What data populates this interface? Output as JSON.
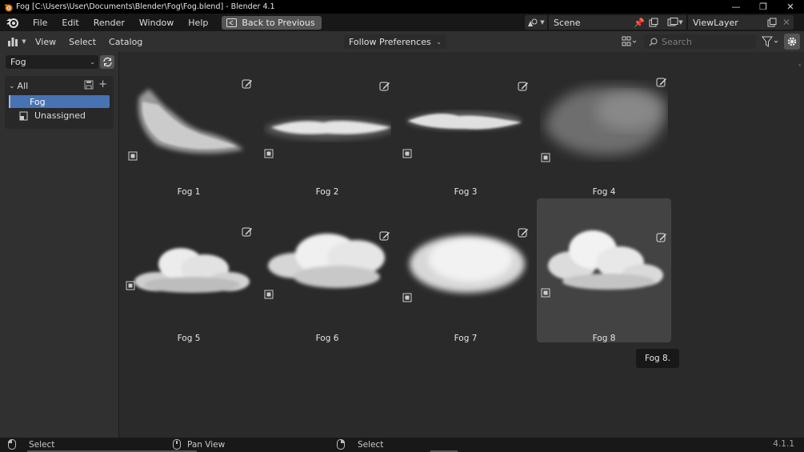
{
  "window": {
    "title": "Fog [C:\\Users\\User\\Documents\\Blender\\Fog\\Fog.blend] - Blender 4.1",
    "controls": [
      "minimize-icon",
      "restore-icon",
      "close-icon"
    ]
  },
  "menubar": {
    "items": [
      "File",
      "Edit",
      "Render",
      "Window",
      "Help"
    ],
    "back_button": "Back to Previous",
    "scene": "Scene",
    "view_layer": "ViewLayer"
  },
  "editor_header": {
    "menus": [
      "View",
      "Select",
      "Catalog"
    ],
    "import_method": "Follow Preferences",
    "search_placeholder": "Search"
  },
  "sidebar": {
    "library": "Fog",
    "catalog_root": "All",
    "catalogs": [
      "Fog"
    ],
    "unassigned": "Unassigned"
  },
  "assets": [
    {
      "name": "Fog 1"
    },
    {
      "name": "Fog 2"
    },
    {
      "name": "Fog 3"
    },
    {
      "name": "Fog 4"
    },
    {
      "name": "Fog 5"
    },
    {
      "name": "Fog 6"
    },
    {
      "name": "Fog 7"
    },
    {
      "name": "Fog 8"
    }
  ],
  "tooltip": "Fog 8.",
  "statusbar": {
    "left": "Select",
    "middle": "Pan View",
    "right": "Select",
    "version": "4.1.1"
  },
  "colors": {
    "accent": "#4772b3",
    "background": "#2a2a2a",
    "header": "#303030"
  }
}
